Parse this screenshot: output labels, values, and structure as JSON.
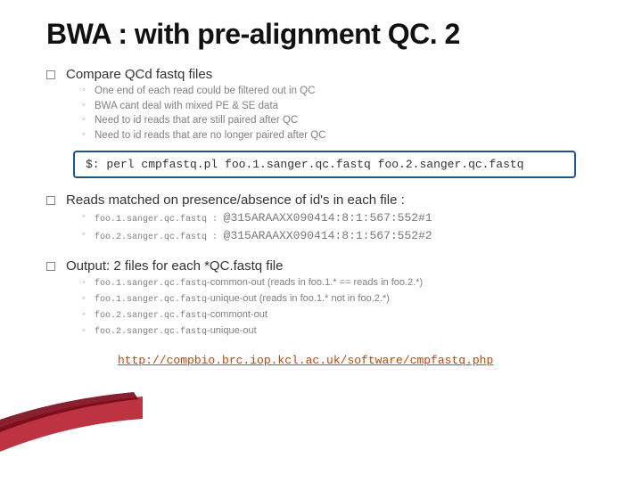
{
  "title": "BWA : with pre-alignment QC. 2",
  "sections": {
    "compare": {
      "heading": "Compare QCd fastq files",
      "items": [
        "One end of each read could be filtered out in QC",
        "BWA cant deal with mixed PE & SE data",
        "Need to id reads that are still paired after QC",
        "Need to id reads that are no longer paired after QC"
      ]
    },
    "command": "$: perl cmpfastq.pl foo.1.sanger.qc.fastq foo.2.sanger.qc.fastq",
    "reads": {
      "heading": "Reads matched on presence/absence of id's in each file :",
      "items": [
        {
          "label": "foo.1.sanger.qc.fastq :",
          "id": "@315ARAAXX090414:8:1:567:552#1"
        },
        {
          "label": "foo.2.sanger.qc.fastq :",
          "id": "@315ARAAXX090414:8:1:567:552#2"
        }
      ]
    },
    "output": {
      "heading": "Output: 2 files for each *QC.fastq file",
      "items": [
        {
          "file": "foo.1.sanger.qc.fastq",
          "suffix": "-common-out",
          "note": " (reads in foo.1.* == reads in foo.2.*)"
        },
        {
          "file": "foo.1.sanger.qc.fastq",
          "suffix": "-unique-out",
          "note": " (reads in foo.1.* not in foo.2.*)"
        },
        {
          "file": "foo.2.sanger.qc.fastq",
          "suffix": "-commont-out",
          "note": ""
        },
        {
          "file": "foo.2.sanger.qc.fastq",
          "suffix": "-unique-out",
          "note": ""
        }
      ]
    },
    "link": "http://compbio.brc.iop.kcl.ac.uk/software/cmpfastq.php"
  }
}
